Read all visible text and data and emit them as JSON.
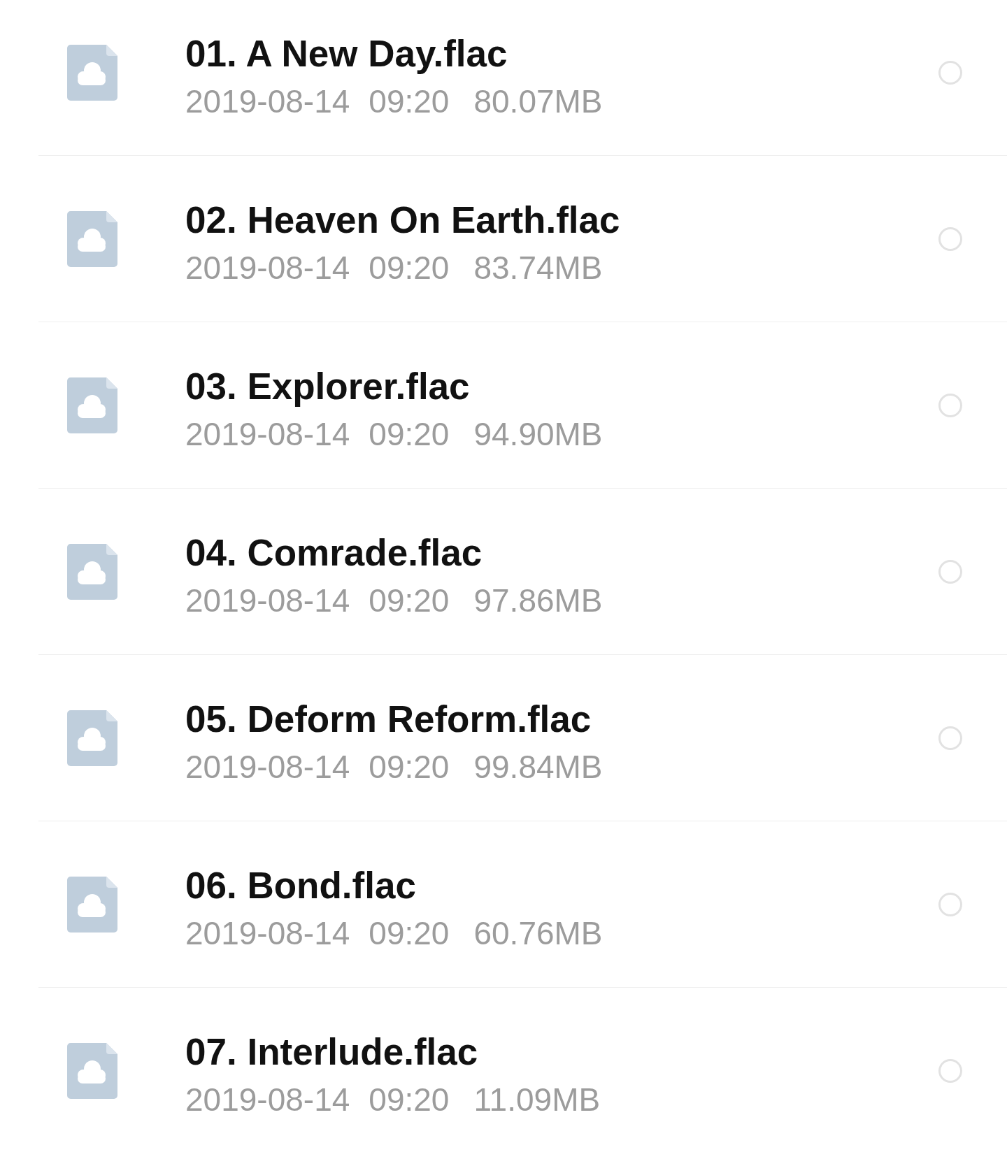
{
  "files": [
    {
      "name": "01. A New Day.flac",
      "date": "2019-08-14",
      "time": "09:20",
      "size": "80.07MB",
      "selected": false
    },
    {
      "name": "02. Heaven On Earth.flac",
      "date": "2019-08-14",
      "time": "09:20",
      "size": "83.74MB",
      "selected": false
    },
    {
      "name": "03. Explorer.flac",
      "date": "2019-08-14",
      "time": "09:20",
      "size": "94.90MB",
      "selected": false
    },
    {
      "name": "04. Comrade.flac",
      "date": "2019-08-14",
      "time": "09:20",
      "size": "97.86MB",
      "selected": false
    },
    {
      "name": "05. Deform Reform.flac",
      "date": "2019-08-14",
      "time": "09:20",
      "size": "99.84MB",
      "selected": false
    },
    {
      "name": "06. Bond.flac",
      "date": "2019-08-14",
      "time": "09:20",
      "size": "60.76MB",
      "selected": false
    },
    {
      "name": "07. Interlude.flac",
      "date": "2019-08-14",
      "time": "09:20",
      "size": "11.09MB",
      "selected": false
    }
  ]
}
